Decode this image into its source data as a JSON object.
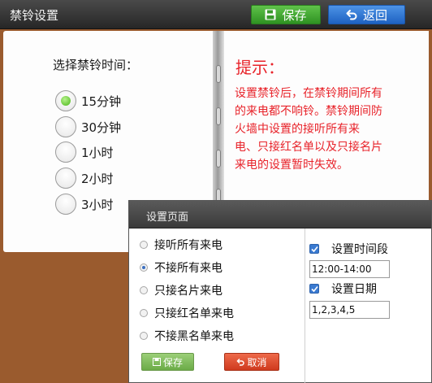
{
  "header": {
    "title": "禁铃设置",
    "save_label": "保存",
    "back_label": "返回"
  },
  "left_page": {
    "prompt": "选择禁铃时间：",
    "options": [
      {
        "label": "15分钟",
        "selected": true
      },
      {
        "label": "30分钟",
        "selected": false
      },
      {
        "label": "1小时",
        "selected": false
      },
      {
        "label": "2小时",
        "selected": false
      },
      {
        "label": "3小时",
        "selected": false
      }
    ]
  },
  "right_page": {
    "tip_title": "提示：",
    "tip_lines": [
      "设置禁铃后，在禁铃期间所有",
      "的来电都不响铃。禁铃期间防",
      "火墙中设置的接听所有来",
      "电、只接红名单以及只接名片",
      "来电的设置暂时失效。"
    ]
  },
  "dialog": {
    "title": "设置页面",
    "options": [
      {
        "label": "接听所有来电",
        "selected": false
      },
      {
        "label": "不接所有来电",
        "selected": true
      },
      {
        "label": "只接名片来电",
        "selected": false
      },
      {
        "label": "只接红名单来电",
        "selected": false
      },
      {
        "label": "不接黑名单来电",
        "selected": false
      }
    ],
    "save_label": "保存",
    "cancel_label": "取消",
    "time_check_label": "设置时间段",
    "time_value": "12:00-14:00",
    "date_check_label": "设置日期",
    "date_value": "1,2,3,4,5"
  },
  "colors": {
    "tip_red": "#e8232a",
    "save_green": "#2f9222",
    "back_blue": "#1e62c2",
    "frame_wood": "#9a5b2e"
  },
  "icons": {
    "save": "floppy-disk-icon",
    "back": "return-arrow-icon",
    "check": "checkmark-icon"
  }
}
